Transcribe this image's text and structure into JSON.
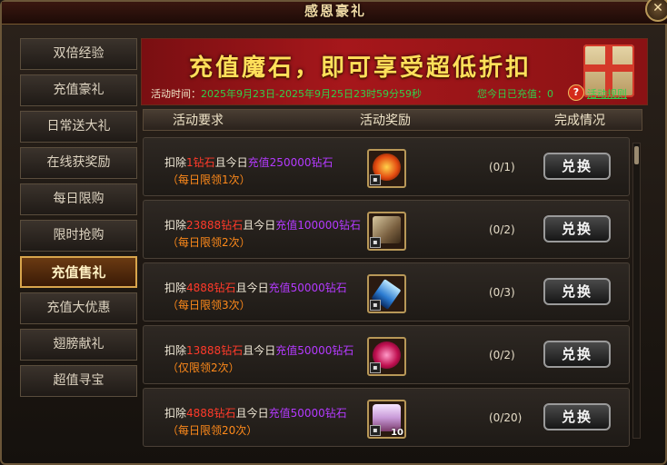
{
  "window": {
    "title": "感恩豪礼",
    "close_label": "✕"
  },
  "sidebar": {
    "items": [
      {
        "label": "双倍经验"
      },
      {
        "label": "充值豪礼"
      },
      {
        "label": "日常送大礼"
      },
      {
        "label": "在线获奖励"
      },
      {
        "label": "每日限购"
      },
      {
        "label": "限时抢购"
      },
      {
        "label": "充值售礼",
        "active": true
      },
      {
        "label": "充值大优惠"
      },
      {
        "label": "翅膀献礼"
      },
      {
        "label": "超值寻宝"
      }
    ]
  },
  "banner": {
    "slogan": "充值魔石，即可享受超低折扣",
    "time_label": "活动时间：",
    "time_value": "2025年9月23日-2025年9月25日23时59分59秒",
    "recharge_label": "您今日已充值：",
    "recharge_value": "0",
    "rules_label": "活动规则",
    "help_icon": "?"
  },
  "table": {
    "headers": [
      "活动要求",
      "活动奖励",
      "完成情况"
    ]
  },
  "rows": [
    {
      "pre": "扣除",
      "deduct": "1钻石",
      "mid": "且今日",
      "recharge": "充值250000钻石",
      "limit": "（每日限领1次）",
      "progress": "(0/1)",
      "button": "兑换",
      "reward_icon": "fire-orb-icon",
      "qty": ""
    },
    {
      "pre": "扣除",
      "deduct": "23888钻石",
      "mid": "且今日",
      "recharge": "充值100000钻石",
      "limit": "（每日限领2次）",
      "progress": "(0/2)",
      "button": "兑换",
      "reward_icon": "medal-icon",
      "qty": ""
    },
    {
      "pre": "扣除",
      "deduct": "4888钻石",
      "mid": "且今日",
      "recharge": "充值50000钻石",
      "limit": "（每日限领3次）",
      "progress": "(0/3)",
      "button": "兑换",
      "reward_icon": "crystal-icon",
      "qty": ""
    },
    {
      "pre": "扣除",
      "deduct": "13888钻石",
      "mid": "且今日",
      "recharge": "充值50000钻石",
      "limit": "（仅限领2次）",
      "progress": "(0/2)",
      "button": "兑换",
      "reward_icon": "red-orb-icon",
      "qty": ""
    },
    {
      "pre": "扣除",
      "deduct": "4888钻石",
      "mid": "且今日",
      "recharge": "充值50000钻石",
      "limit": "（每日限领20次）",
      "progress": "(0/20)",
      "button": "兑换",
      "reward_icon": "pet-icon",
      "qty": "10"
    }
  ],
  "colors": {
    "deduct": "#ff3a2a",
    "recharge": "#b43aff",
    "limit": "#ff8a1a",
    "time": "#31d04b",
    "banner": "#a6171b",
    "slogan": "#ffe05a"
  }
}
